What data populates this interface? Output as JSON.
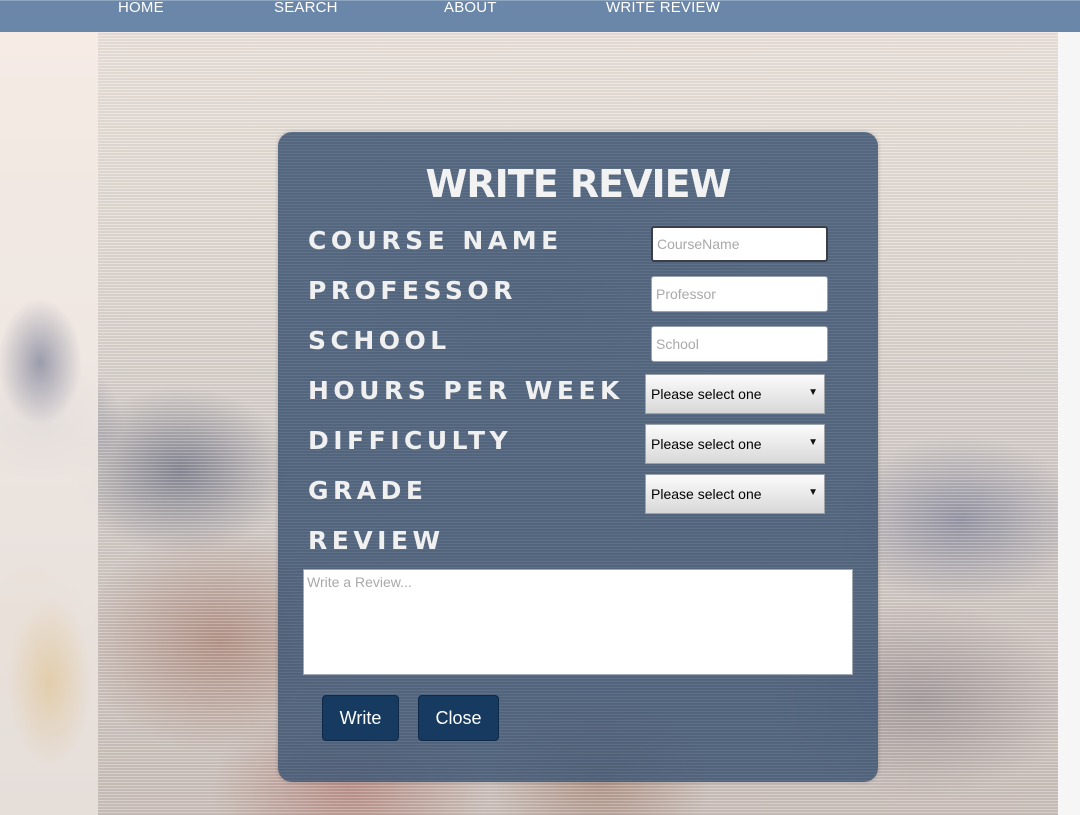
{
  "nav": {
    "items": [
      {
        "label": "HOME"
      },
      {
        "label": "SEARCH"
      },
      {
        "label": "ABOUT"
      },
      {
        "label": "WRITE REVIEW"
      }
    ]
  },
  "dialog": {
    "title": "WRITE REVIEW",
    "labels": {
      "course_name": "COURSE NAME",
      "professor": "PROFESSOR",
      "school": "SCHOOL",
      "hours_per_week": "HOURS PER WEEK",
      "difficulty": "DIFFICULTY",
      "grade": "GRADE",
      "review": "REVIEW"
    },
    "inputs": {
      "course_name_placeholder": "CourseName",
      "professor_placeholder": "Professor",
      "school_placeholder": "School",
      "review_placeholder": "Write a Review..."
    },
    "selects": {
      "hours_per_week": "Please select one",
      "difficulty": "Please select one",
      "grade": "Please select one"
    },
    "buttons": {
      "write": "Write",
      "close": "Close"
    }
  }
}
